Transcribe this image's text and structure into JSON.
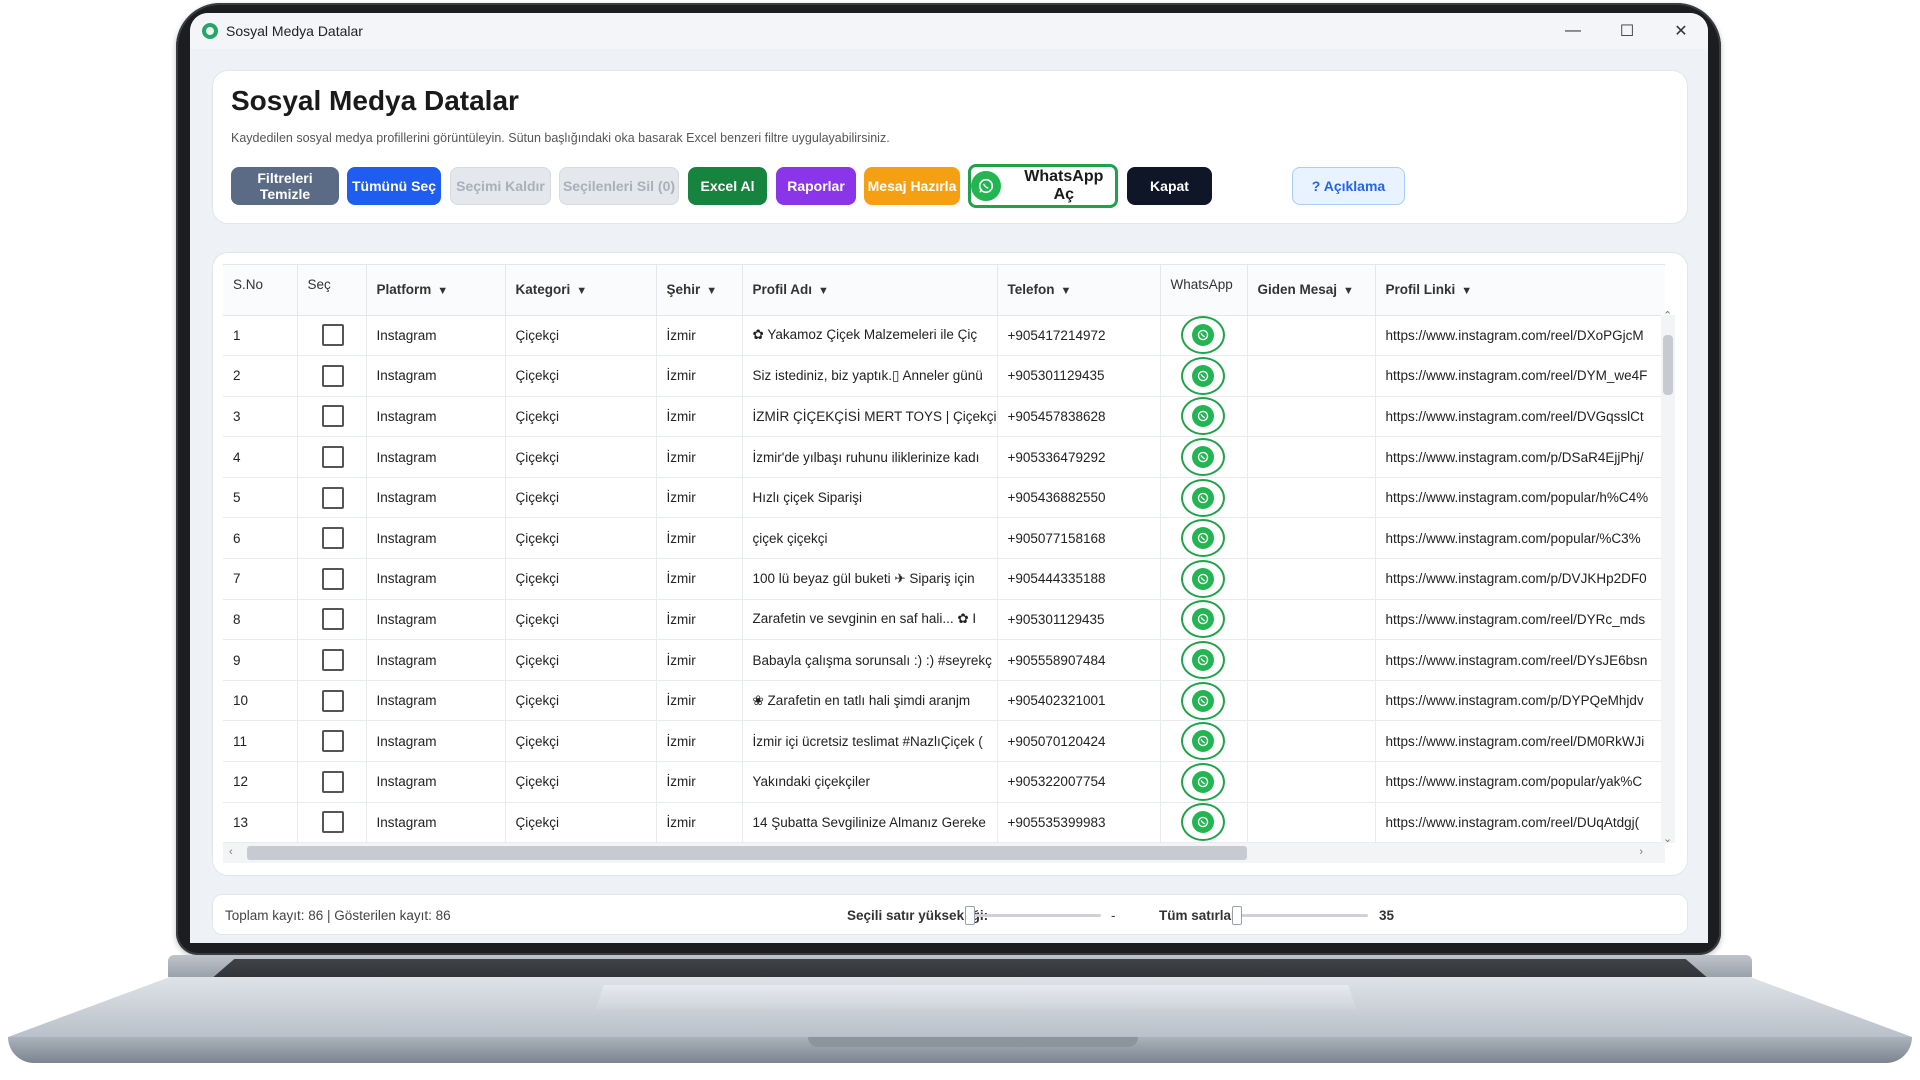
{
  "window": {
    "title": "Sosyal Medya Datalar",
    "minimize": "—",
    "maximize": "☐",
    "close": "✕"
  },
  "header": {
    "title": "Sosyal Medya Datalar",
    "subtitle": "Kaydedilen sosyal medya profillerini görüntüleyin. Sütun başlığındaki oka basarak Excel benzeri filtre uygulayabilirsiniz."
  },
  "toolbar": {
    "clear_filters": "Filtreleri Temizle",
    "select_all": "Tümünü Seç",
    "deselect": "Seçimi Kaldır",
    "delete_selected": "Seçilenleri Sil (0)",
    "export_excel": "Excel Al",
    "reports": "Raporlar",
    "prepare_message": "Mesaj Hazırla",
    "open_whatsapp": "WhatsApp Aç",
    "close": "Kapat",
    "help": "? Açıklama"
  },
  "table": {
    "columns": [
      "S.No",
      "Seç",
      "Platform",
      "Kategori",
      "Şehir",
      "Profil Adı",
      "Telefon",
      "WhatsApp",
      "Giden Mesaj",
      "Profil Linki"
    ],
    "filter_arrow": "▼",
    "rows": [
      {
        "no": "1",
        "platform": "Instagram",
        "category": "Çiçekçi",
        "city": "İzmir",
        "profile": "✿ Yakamoz Çiçek Malzemeleri ile Çiç",
        "phone": "+905417214972",
        "message": "",
        "link": "https://www.instagram.com/reel/DXoPGjcM"
      },
      {
        "no": "2",
        "platform": "Instagram",
        "category": "Çiçekçi",
        "city": "İzmir",
        "profile": "Siz istediniz, biz yaptık.▯ Anneler günü",
        "phone": "+905301129435",
        "message": "",
        "link": "https://www.instagram.com/reel/DYM_we4F"
      },
      {
        "no": "3",
        "platform": "Instagram",
        "category": "Çiçekçi",
        "city": "İzmir",
        "profile": "İZMİR ÇİÇEKÇİSİ MERT TOYS | Çiçekçi '",
        "phone": "+905457838628",
        "message": "",
        "link": "https://www.instagram.com/reel/DVGqsslCt"
      },
      {
        "no": "4",
        "platform": "Instagram",
        "category": "Çiçekçi",
        "city": "İzmir",
        "profile": "İzmir'de yılbaşı ruhunu iliklerinize kadı",
        "phone": "+905336479292",
        "message": "",
        "link": "https://www.instagram.com/p/DSaR4EjjPhj/"
      },
      {
        "no": "5",
        "platform": "Instagram",
        "category": "Çiçekçi",
        "city": "İzmir",
        "profile": "Hızlı çiçek Siparişi",
        "phone": "+905436882550",
        "message": "",
        "link": "https://www.instagram.com/popular/h%C4%"
      },
      {
        "no": "6",
        "platform": "Instagram",
        "category": "Çiçekçi",
        "city": "İzmir",
        "profile": "çiçek çiçekçi",
        "phone": "+905077158168",
        "message": "",
        "link": "https://www.instagram.com/popular/%C3%"
      },
      {
        "no": "7",
        "platform": "Instagram",
        "category": "Çiçekçi",
        "city": "İzmir",
        "profile": "100 lü beyaz gül buketi ✈ Sipariş için",
        "phone": "+905444335188",
        "message": "",
        "link": "https://www.instagram.com/p/DVJKHp2DF0"
      },
      {
        "no": "8",
        "platform": "Instagram",
        "category": "Çiçekçi",
        "city": "İzmir",
        "profile": "Zarafetin ve sevginin en saf hali... ✿ I",
        "phone": "+905301129435",
        "message": "",
        "link": "https://www.instagram.com/reel/DYRc_mds"
      },
      {
        "no": "9",
        "platform": "Instagram",
        "category": "Çiçekçi",
        "city": "İzmir",
        "profile": "Babayla çalışma sorunsalı :) :) #seyrekç",
        "phone": "+905558907484",
        "message": "",
        "link": "https://www.instagram.com/reel/DYsJE6bsn"
      },
      {
        "no": "10",
        "platform": "Instagram",
        "category": "Çiçekçi",
        "city": "İzmir",
        "profile": "❀ Zarafetin en tatlı hali şimdi aranjm",
        "phone": "+905402321001",
        "message": "",
        "link": "https://www.instagram.com/p/DYPQeMhjdv"
      },
      {
        "no": "11",
        "platform": "Instagram",
        "category": "Çiçekçi",
        "city": "İzmir",
        "profile": "İzmir içi ücretsiz teslimat #NazlıÇiçek (",
        "phone": "+905070120424",
        "message": "",
        "link": "https://www.instagram.com/reel/DM0RkWJi"
      },
      {
        "no": "12",
        "platform": "Instagram",
        "category": "Çiçekçi",
        "city": "İzmir",
        "profile": "Yakındaki çiçekçiler",
        "phone": "+905322007754",
        "message": "",
        "link": "https://www.instagram.com/popular/yak%C"
      },
      {
        "no": "13",
        "platform": "Instagram",
        "category": "Çiçekçi",
        "city": "İzmir",
        "profile": "14 Şubatta Sevgilinize Almanız Gereke",
        "phone": "+905535399983",
        "message": "",
        "link": "https://www.instagram.com/reel/DUqAtdgj("
      }
    ]
  },
  "footer": {
    "counts": "Toplam kayıt: 86 | Gösterilen kayıt: 86",
    "row_height_label": "Seçili satır yüksekliği:",
    "row_height_value": "-",
    "all_rows_label": "Tüm satırlar:",
    "all_rows_value": "35"
  },
  "colors": {
    "whatsapp": "#22b552",
    "accent_blue": "#1f5cf0",
    "excel_green": "#16843f",
    "reports_purple": "#8a35ea",
    "message_orange": "#f4a012"
  }
}
